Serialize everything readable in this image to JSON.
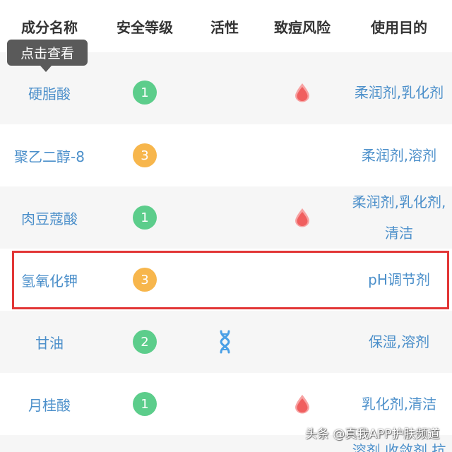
{
  "header": {
    "columns": [
      "成分名称",
      "安全等级",
      "活性",
      "致痘风险",
      "使用目的"
    ]
  },
  "tooltip": {
    "label": "点击查看"
  },
  "colors": {
    "header_text": "#333333",
    "link_text": "#4b8fca",
    "alt_row_bg": "#f6f6f6",
    "badge_green": "#5ccd8b",
    "badge_orange": "#f7b64c",
    "drop_red": "#f05f5f",
    "dna_blue": "#4aa0e6",
    "highlight_border": "#e23636",
    "tooltip_bg": "#5a5a5a"
  },
  "rows": [
    {
      "name": "硬脂酸",
      "safety": "1",
      "safety_badge": "green",
      "acne_risk_icon": "drop-icon",
      "purpose_lines": [
        "柔润剂,乳化剂"
      ]
    },
    {
      "name": "聚乙二醇-8",
      "safety": "3",
      "safety_badge": "orange",
      "purpose_lines": [
        "柔润剂,溶剂"
      ]
    },
    {
      "name": "肉豆蔻酸",
      "safety": "1",
      "safety_badge": "green",
      "acne_risk_icon": "drop-icon",
      "purpose_lines": [
        "柔润剂,乳化剂,",
        "清洁"
      ]
    },
    {
      "name": "氢氧化钾",
      "safety": "3",
      "safety_badge": "orange",
      "purpose_lines": [
        "pH调节剂"
      ],
      "highlighted": true
    },
    {
      "name": "甘油",
      "safety": "2",
      "safety_badge": "green",
      "activity_icon": "dna-icon",
      "purpose_lines": [
        "保湿,溶剂"
      ]
    },
    {
      "name": "月桂酸",
      "safety": "1",
      "safety_badge": "green",
      "acne_risk_icon": "drop-icon",
      "purpose_lines": [
        "乳化剂,清洁"
      ]
    },
    {
      "purpose_lines": [
        "溶剂,收敛剂,抗"
      ]
    }
  ],
  "watermark": "头条 @真我APP护肤频道"
}
